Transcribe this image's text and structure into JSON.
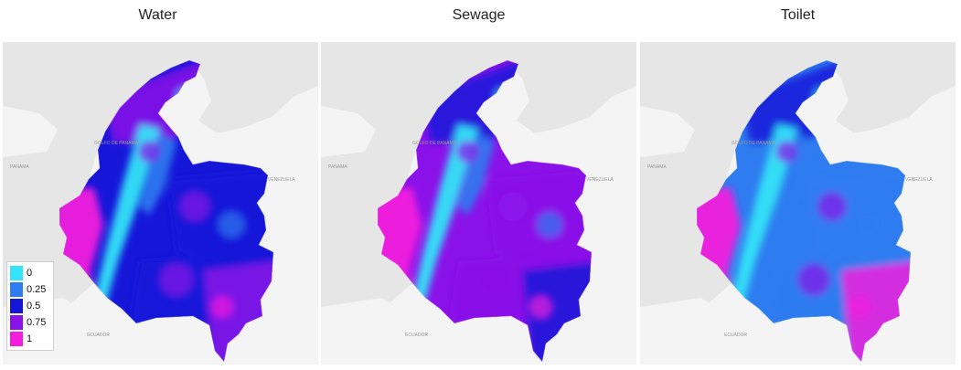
{
  "panels": [
    {
      "title": "Water"
    },
    {
      "title": "Sewage"
    },
    {
      "title": "Toilet"
    }
  ],
  "basemap_labels": [
    "PANAMA",
    "GOLFO DE PANAMA",
    "VENEZUELA",
    "ECUADOR"
  ],
  "legend": {
    "items": [
      {
        "label": "0",
        "color": "#33e3f7"
      },
      {
        "label": "0.25",
        "color": "#2e7cf0"
      },
      {
        "label": "0.5",
        "color": "#1616d9"
      },
      {
        "label": "0.75",
        "color": "#8a12e8"
      },
      {
        "label": "1",
        "color": "#f21ddd"
      }
    ]
  },
  "colors": {
    "land": "#f4f4f4",
    "sea": "#e6e6e6",
    "cyan": "#33e3f7",
    "blue": "#1616d9",
    "light_blue": "#2e7cf0",
    "purple": "#8a12e8",
    "magenta": "#f21ddd"
  }
}
